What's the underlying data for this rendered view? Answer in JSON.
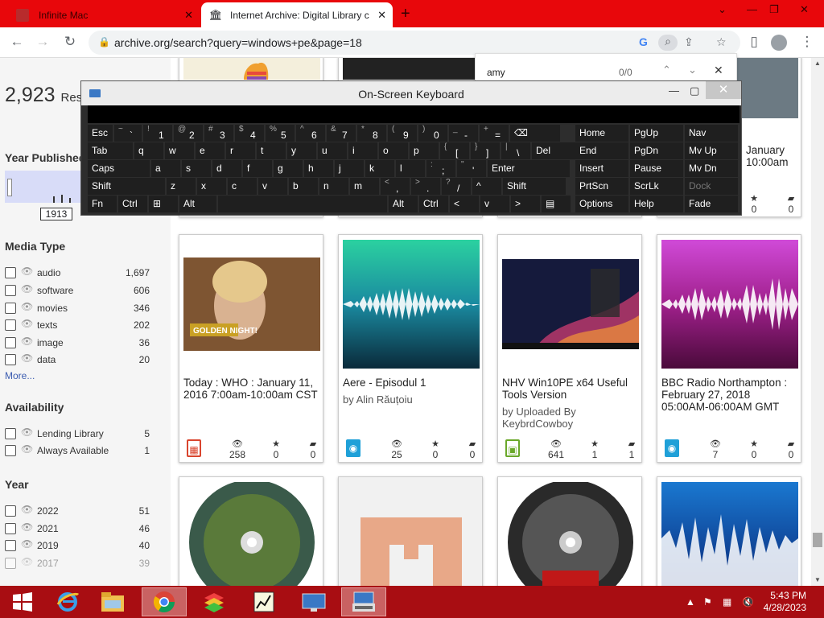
{
  "browser": {
    "tabs": [
      {
        "title": "Infinite Mac",
        "active": false
      },
      {
        "title": "Internet Archive: Digital Library c",
        "active": true
      }
    ],
    "new_tab_glyph": "+",
    "url": "archive.org/search?query=windows+pe&page=18",
    "accent_color": "#e8070b"
  },
  "find_bar": {
    "query": "amy",
    "count": "0/0"
  },
  "osk": {
    "title": "On-Screen Keyboard",
    "rows": [
      [
        {
          "m": "Esc"
        },
        {
          "s": "~",
          "m": "`"
        },
        {
          "s": "!",
          "m": "1"
        },
        {
          "s": "@",
          "m": "2"
        },
        {
          "s": "#",
          "m": "3"
        },
        {
          "s": "$",
          "m": "4"
        },
        {
          "s": "%",
          "m": "5"
        },
        {
          "s": "^",
          "m": "6"
        },
        {
          "s": "&",
          "m": "7"
        },
        {
          "s": "*",
          "m": "8"
        },
        {
          "s": "(",
          "m": "9"
        },
        {
          "s": ")",
          "m": "0"
        },
        {
          "s": "_",
          "m": "-"
        },
        {
          "s": "+",
          "m": "="
        },
        {
          "m": "⌫"
        }
      ],
      [
        {
          "m": "Tab"
        },
        {
          "m": "q"
        },
        {
          "m": "w"
        },
        {
          "m": "e"
        },
        {
          "m": "r"
        },
        {
          "m": "t"
        },
        {
          "m": "y"
        },
        {
          "m": "u"
        },
        {
          "m": "i"
        },
        {
          "m": "o"
        },
        {
          "m": "p"
        },
        {
          "s": "{",
          "m": "["
        },
        {
          "s": "}",
          "m": "]"
        },
        {
          "s": "|",
          "m": "\\"
        },
        {
          "m": "Del"
        }
      ],
      [
        {
          "m": "Caps"
        },
        {
          "m": "a"
        },
        {
          "m": "s"
        },
        {
          "m": "d"
        },
        {
          "m": "f"
        },
        {
          "m": "g"
        },
        {
          "m": "h"
        },
        {
          "m": "j"
        },
        {
          "m": "k"
        },
        {
          "m": "l"
        },
        {
          "s": ":",
          "m": ";"
        },
        {
          "s": "\"",
          "m": "'"
        },
        {
          "m": "Enter"
        }
      ],
      [
        {
          "m": "Shift"
        },
        {
          "m": "z"
        },
        {
          "m": "x"
        },
        {
          "m": "c"
        },
        {
          "m": "v"
        },
        {
          "m": "b"
        },
        {
          "m": "n"
        },
        {
          "m": "m"
        },
        {
          "s": "<",
          "m": ","
        },
        {
          "s": ">",
          "m": "."
        },
        {
          "s": "?",
          "m": "/"
        },
        {
          "m": "^"
        },
        {
          "m": "Shift"
        }
      ],
      [
        {
          "m": "Fn"
        },
        {
          "m": "Ctrl"
        },
        {
          "m": "⊞"
        },
        {
          "m": "Alt"
        },
        {
          "m": ""
        },
        {
          "m": "Alt"
        },
        {
          "m": "Ctrl"
        },
        {
          "m": "<"
        },
        {
          "m": "v"
        },
        {
          "m": ">"
        },
        {
          "m": "▤"
        }
      ]
    ],
    "nav_keys": [
      [
        "Home",
        "PgUp",
        "Nav"
      ],
      [
        "End",
        "PgDn",
        "Mv Up"
      ],
      [
        "Insert",
        "Pause",
        "Mv Dn"
      ],
      [
        "PrtScn",
        "ScrLk",
        "Dock"
      ],
      [
        "Options",
        "Help",
        "Fade"
      ]
    ]
  },
  "sidebar": {
    "results_count": "2,923",
    "results_label": "Resu",
    "year_published_heading": "Year Published",
    "year_from": "1913",
    "media_type_heading": "Media Type",
    "media_types": [
      {
        "name": "audio",
        "count": "1,697"
      },
      {
        "name": "software",
        "count": "606"
      },
      {
        "name": "movies",
        "count": "346"
      },
      {
        "name": "texts",
        "count": "202"
      },
      {
        "name": "image",
        "count": "36"
      },
      {
        "name": "data",
        "count": "20"
      }
    ],
    "more_label": "More...",
    "availability_heading": "Availability",
    "availability": [
      {
        "name": "Lending Library",
        "count": "5"
      },
      {
        "name": "Always Available",
        "count": "1"
      }
    ],
    "year_heading": "Year",
    "years": [
      {
        "name": "2022",
        "count": "51"
      },
      {
        "name": "2021",
        "count": "46"
      },
      {
        "name": "2019",
        "count": "40"
      },
      {
        "name": "2017",
        "count": "39"
      }
    ]
  },
  "results_top": [
    {
      "title": "",
      "by": "",
      "stats": [
        "",
        "",
        ""
      ]
    },
    {
      "title": "",
      "by": "",
      "stats": [
        "",
        "",
        ""
      ]
    },
    {
      "title": "",
      "by": "",
      "stats": [
        "",
        "",
        ""
      ]
    },
    {
      "title": "January",
      "title2": "10:00am",
      "stats": [
        "0",
        "0"
      ]
    }
  ],
  "results": [
    {
      "title": "Today : WHO : January 11, 2016 7:00am-10:00am CST",
      "by": "",
      "media": "movies",
      "views": "258",
      "favs": "0",
      "reviews": "0"
    },
    {
      "title": "Aere - Episodul 1",
      "by": "by Alin Răuțoiu",
      "media": "audio",
      "views": "25",
      "favs": "0",
      "reviews": "0"
    },
    {
      "title": "NHV Win10PE x64 Useful Tools Version",
      "by": "by Uploaded By KeybrdCowboy",
      "media": "software",
      "views": "641",
      "favs": "1",
      "reviews": "1"
    },
    {
      "title": "BBC Radio Northampton : February 27, 2018 05:00AM-06:00AM GMT",
      "by": "",
      "media": "audio",
      "views": "7",
      "favs": "0",
      "reviews": "0"
    }
  ],
  "taskbar": {
    "time": "5:43 PM",
    "date": "4/28/2023",
    "apps": [
      "start",
      "ie",
      "explorer",
      "chrome",
      "bluestacks",
      "chart-app",
      "remote-desktop",
      "on-screen-keyboard"
    ]
  }
}
